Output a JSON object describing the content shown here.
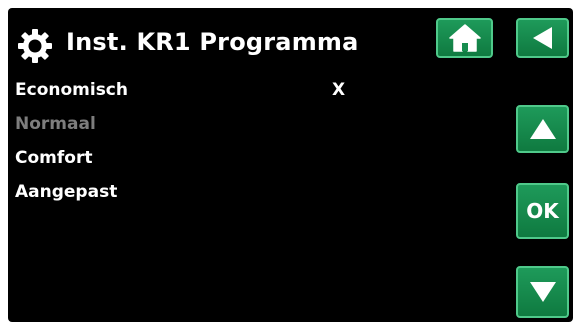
{
  "header": {
    "title": "Inst. KR1 Programma",
    "icon": "gear-icon"
  },
  "nav": {
    "home_icon": "home-icon",
    "back_icon": "back-arrow-icon",
    "up_icon": "up-arrow-icon",
    "down_icon": "down-arrow-icon",
    "ok_label": "OK"
  },
  "menu": {
    "items": [
      {
        "label": "Economisch",
        "selected_mark": "X",
        "enabled": true
      },
      {
        "label": "Normaal",
        "selected_mark": "",
        "enabled": false
      },
      {
        "label": "Comfort",
        "selected_mark": "",
        "enabled": true
      },
      {
        "label": "Aangepast",
        "selected_mark": "",
        "enabled": true
      }
    ]
  },
  "colors": {
    "background": "#000000",
    "button_green": "#1a8a4e",
    "button_border": "#4fc98a",
    "text": "#ffffff",
    "disabled_text": "#7d7d7d"
  }
}
